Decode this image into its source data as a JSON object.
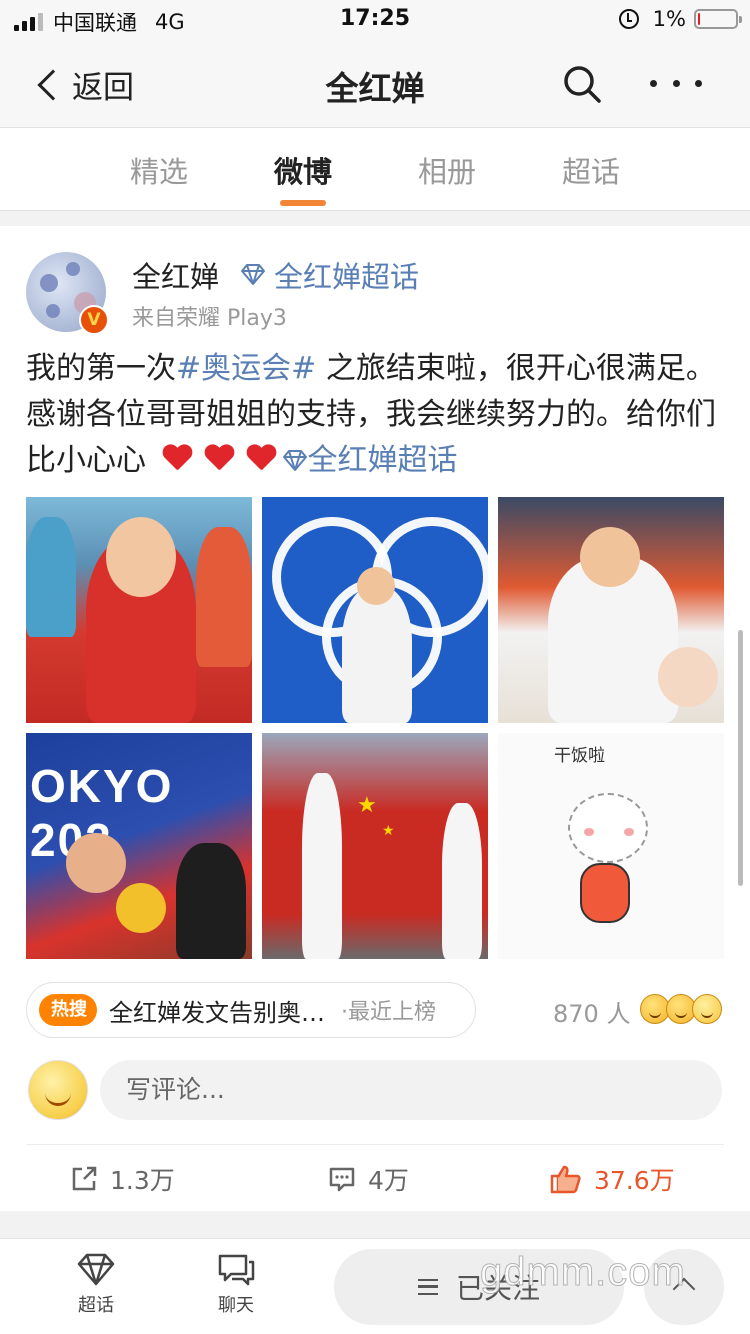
{
  "status_bar": {
    "carrier": "中国联通",
    "network": "4G",
    "time": "17:25",
    "battery_percent": "1%",
    "battery_level": 0.01
  },
  "nav": {
    "back_label": "返回",
    "title": "全红婵",
    "search_icon": "search-icon",
    "more_icon": "more-icon"
  },
  "tabs": [
    {
      "label": "精选",
      "active": false
    },
    {
      "label": "微博",
      "active": true
    },
    {
      "label": "相册",
      "active": false
    },
    {
      "label": "超话",
      "active": false
    }
  ],
  "post": {
    "author": "全红婵",
    "topic": "全红婵超话",
    "source": "来自荣耀 Play3",
    "text_part1": "我的第一次",
    "hashtag": "#奥运会#",
    "text_part2": " 之旅结束啦，很开心很满足。感谢各位哥哥姐姐的支持，我会继续努力的。给你们比小心心",
    "text_topic": "全红婵超话",
    "photo_texts": {
      "tokyo": "OKYO 202",
      "sticker": "干饭啦"
    },
    "trending": {
      "badge": "热搜",
      "title": "全红婵发文告别奥运会",
      "suffix": "·最近上榜"
    },
    "reaction_count": "870 人",
    "comment_placeholder": "写评论...",
    "actions": {
      "share": "1.3万",
      "comment": "4万",
      "like": "37.6万"
    }
  },
  "bottom_bar": {
    "chaohua_label": "超话",
    "chat_label": "聊天",
    "follow_label": "已关注"
  },
  "watermark": "gdmm.com",
  "colors": {
    "accent_orange": "#f38536",
    "link_blue": "#5a7fb5",
    "like_red": "#e8562a",
    "trend_orange": "#ff8200"
  }
}
